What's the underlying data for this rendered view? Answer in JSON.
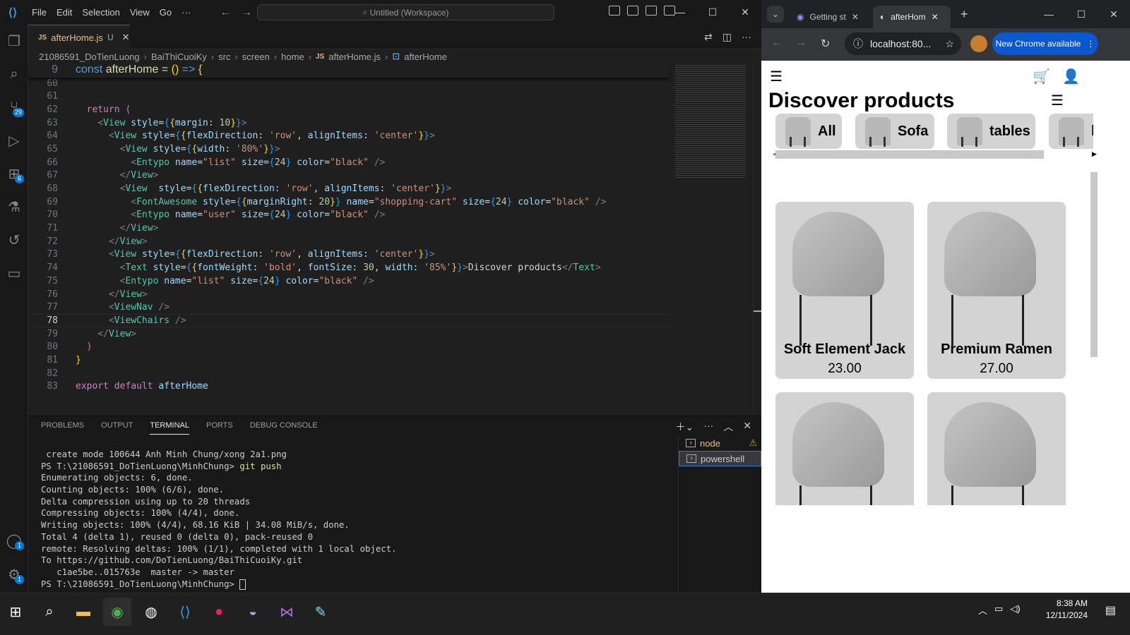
{
  "vscode": {
    "menu": [
      "File",
      "Edit",
      "Selection",
      "View",
      "Go",
      "···"
    ],
    "command_center": "Untitled (Workspace)",
    "tab": {
      "lang": "JS",
      "name": "afterHome.js",
      "status": "U"
    },
    "breadcrumb": [
      "21086591_DoTienLuong",
      "BaiThiCuoiKy",
      "src",
      "screen",
      "home",
      "JS",
      "afterHome.js",
      "afterHome"
    ],
    "activity_badges": {
      "source_control": "29",
      "extensions": "6",
      "accounts": "1",
      "settings": "1"
    },
    "sticky": {
      "ln": "9",
      "code": "const afterHome = () => {"
    },
    "lines": [
      {
        "ln": "60"
      },
      {
        "ln": "61"
      },
      {
        "ln": "62"
      },
      {
        "ln": "63"
      },
      {
        "ln": "64"
      },
      {
        "ln": "65"
      },
      {
        "ln": "66"
      },
      {
        "ln": "67"
      },
      {
        "ln": "68"
      },
      {
        "ln": "69"
      },
      {
        "ln": "70"
      },
      {
        "ln": "71"
      },
      {
        "ln": "72"
      },
      {
        "ln": "73"
      },
      {
        "ln": "74"
      },
      {
        "ln": "75"
      },
      {
        "ln": "76"
      },
      {
        "ln": "77"
      },
      {
        "ln": "78"
      },
      {
        "ln": "79"
      },
      {
        "ln": "80"
      },
      {
        "ln": "81"
      },
      {
        "ln": "82"
      },
      {
        "ln": "83"
      }
    ],
    "panel_tabs": [
      "PROBLEMS",
      "OUTPUT",
      "TERMINAL",
      "PORTS",
      "DEBUG CONSOLE"
    ],
    "terminal": [
      " create mode 100644 Anh Minh Chung/xong 2a1.png",
      "PS T:\\21086591_DoTienLuong\\MinhChung> ",
      "Enumerating objects: 6, done.",
      "Counting objects: 100% (6/6), done.",
      "Delta compression using up to 20 threads",
      "Compressing objects: 100% (4/4), done.",
      "Writing objects: 100% (4/4), 68.16 KiB | 34.08 MiB/s, done.",
      "Total 4 (delta 1), reused 0 (delta 0), pack-reused 0",
      "remote: Resolving deltas: 100% (1/1), completed with 1 local object.",
      "To https://github.com/DoTienLuong/BaiThiCuoiKy.git",
      "   c1ae5be..015763e  master -> master",
      "PS T:\\21086591_DoTienLuong\\MinhChung> "
    ],
    "terminal_cmd": "git push",
    "terminal_list": [
      "node",
      "powershell"
    ]
  },
  "chrome": {
    "tabs": [
      "Getting st",
      "afterHom"
    ],
    "url": "localhost:80...",
    "update_btn": "New Chrome available",
    "page": {
      "title": "Discover products",
      "categories": [
        "All",
        "Sofa",
        "tables",
        "ke"
      ],
      "products": [
        {
          "name": "Soft Element Jack",
          "price": "23.00"
        },
        {
          "name": "Premium Ramen",
          "price": "27.00"
        },
        {
          "name": "",
          "price": ""
        },
        {
          "name": "",
          "price": ""
        }
      ]
    }
  },
  "taskbar": {
    "time": "8:38 AM",
    "date": "12/11/2024"
  }
}
